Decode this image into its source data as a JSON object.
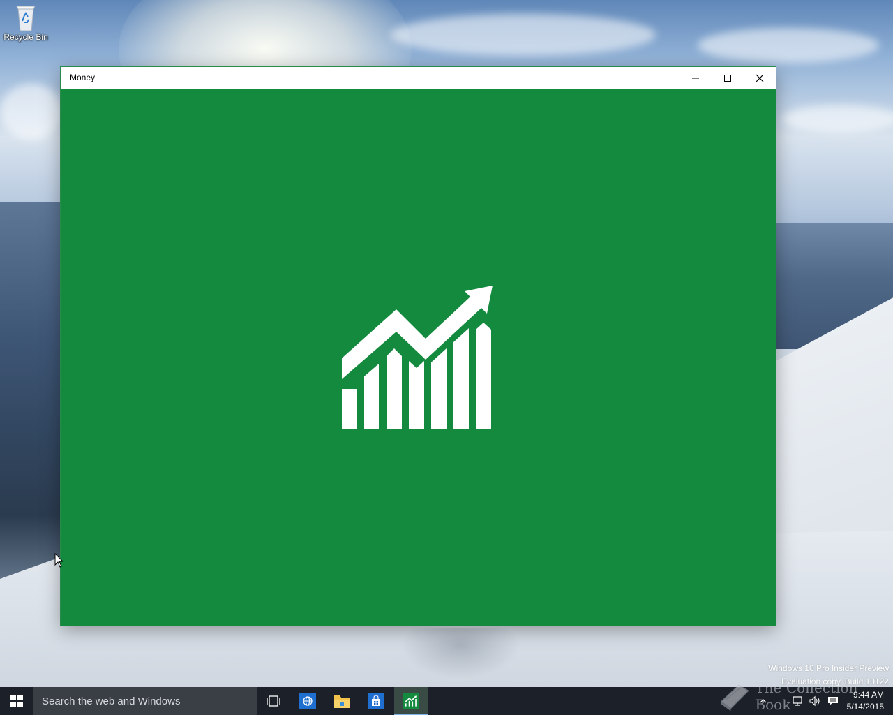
{
  "desktop": {
    "icons": [
      {
        "label": "Recycle Bin",
        "icon": "recycle-bin-icon"
      }
    ],
    "watermark": {
      "line1": "Windows 10 Pro Insider Preview",
      "line2": "Evaluation copy. Build 10122"
    }
  },
  "window": {
    "title": "Money",
    "controls": {
      "minimize": "minimize-icon",
      "maximize": "maximize-icon",
      "close": "close-icon"
    },
    "splash": {
      "background": "#138a3e",
      "logo": "rising-chart-icon"
    }
  },
  "taskbar": {
    "start": "windows-logo-icon",
    "search_placeholder": "Search the web and Windows",
    "pinned": [
      {
        "name": "Task View",
        "icon": "task-view-icon"
      },
      {
        "name": "Internet Explorer",
        "icon": "globe-icon"
      },
      {
        "name": "File Explorer",
        "icon": "folder-icon"
      },
      {
        "name": "Store",
        "icon": "store-bag-icon"
      },
      {
        "name": "Money",
        "icon": "rising-chart-icon",
        "active": true
      }
    ],
    "tray": {
      "icons": [
        "chevron-up-icon",
        "network-icon",
        "volume-icon",
        "action-center-icon"
      ],
      "time": "9:44 AM",
      "date": "5/14/2015"
    },
    "overlay_watermark": "The Collection Book"
  },
  "colors": {
    "money_green": "#138a3e",
    "taskbar": "#1c2129",
    "search_box": "#3a3f46",
    "active_underline": "#7fb3e6"
  }
}
